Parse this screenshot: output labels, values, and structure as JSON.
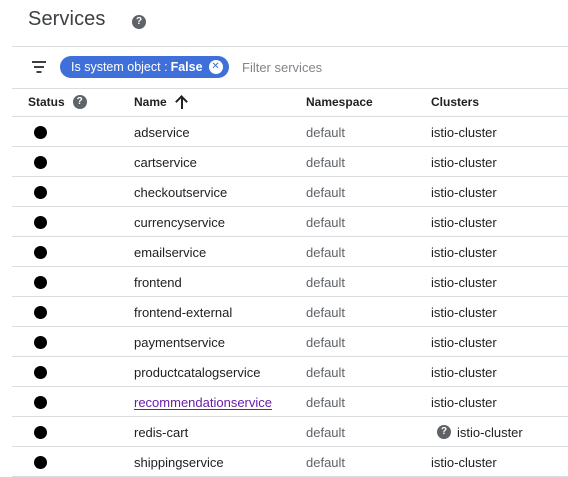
{
  "header": {
    "title": "Services"
  },
  "filter": {
    "chip_key": "Is system object :",
    "chip_value": "False",
    "placeholder": "Filter services"
  },
  "table": {
    "columns": {
      "status": "Status",
      "name": "Name",
      "namespace": "Namespace",
      "clusters": "Clusters"
    },
    "sort": {
      "column": "name",
      "direction": "ascending"
    },
    "rows": [
      {
        "name": "adservice",
        "namespace": "default",
        "cluster": "istio-cluster"
      },
      {
        "name": "cartservice",
        "namespace": "default",
        "cluster": "istio-cluster"
      },
      {
        "name": "checkoutservice",
        "namespace": "default",
        "cluster": "istio-cluster"
      },
      {
        "name": "currencyservice",
        "namespace": "default",
        "cluster": "istio-cluster"
      },
      {
        "name": "emailservice",
        "namespace": "default",
        "cluster": "istio-cluster"
      },
      {
        "name": "frontend",
        "namespace": "default",
        "cluster": "istio-cluster"
      },
      {
        "name": "frontend-external",
        "namespace": "default",
        "cluster": "istio-cluster"
      },
      {
        "name": "paymentservice",
        "namespace": "default",
        "cluster": "istio-cluster"
      },
      {
        "name": "productcatalogservice",
        "namespace": "default",
        "cluster": "istio-cluster"
      },
      {
        "name": "recommendationservice",
        "namespace": "default",
        "cluster": "istio-cluster"
      },
      {
        "name": "redis-cart",
        "namespace": "default",
        "cluster": "istio-cluster"
      },
      {
        "name": "shippingservice",
        "namespace": "default",
        "cluster": "istio-cluster"
      }
    ]
  }
}
